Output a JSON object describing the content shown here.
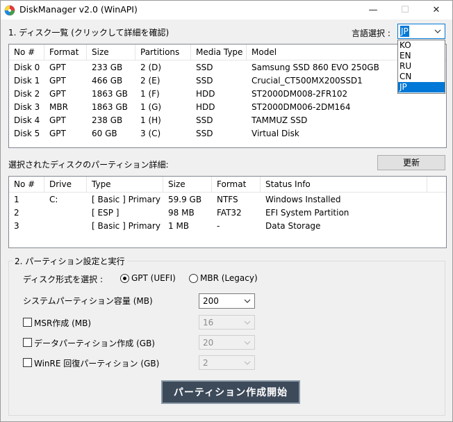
{
  "window": {
    "title": "DiskManager v2.0 (WinAPI)"
  },
  "titlebar": {
    "minimize": "—",
    "maximize": "☐",
    "close": "✕"
  },
  "disk_section": {
    "label": "1. ディスク一覧 (クリックして詳細を確認)"
  },
  "language": {
    "label": "言語選択 :",
    "selected": "JP",
    "options": [
      "KO",
      "EN",
      "RU",
      "CN",
      "JP"
    ]
  },
  "disk_table": {
    "columns": [
      "No #",
      "Format",
      "Size",
      "Partitions",
      "Media Type",
      "Model"
    ],
    "rows": [
      [
        "Disk 0",
        "GPT",
        "233 GB",
        "2 (D)",
        "SSD",
        "Samsung SSD 860 EVO 250GB"
      ],
      [
        "Disk 1",
        "GPT",
        "466 GB",
        "2 (E)",
        "SSD",
        "Crucial_CT500MX200SSD1"
      ],
      [
        "Disk 2",
        "GPT",
        "1863 GB",
        "1 (F)",
        "HDD",
        "ST2000DM008-2FR102"
      ],
      [
        "Disk 3",
        "MBR",
        "1863 GB",
        "1 (G)",
        "HDD",
        "ST2000DM006-2DM164"
      ],
      [
        "Disk 4",
        "GPT",
        "238 GB",
        "1 (H)",
        "SSD",
        "TAMMUZ SSD"
      ],
      [
        "Disk 5",
        "GPT",
        "60 GB",
        "3 (C)",
        "SSD",
        "Virtual Disk"
      ]
    ]
  },
  "partition_section": {
    "label": "選択されたディスクのパーティション詳細:",
    "refresh": "更新"
  },
  "partition_table": {
    "columns": [
      "No #",
      "Drive",
      "Type",
      "Size",
      "Format",
      "Status Info"
    ],
    "rows": [
      [
        "1",
        "C:",
        "[ Basic ] Primary",
        "59.9 GB",
        "NTFS",
        "Windows Installed"
      ],
      [
        "2",
        "",
        "[ ESP ]",
        "98 MB",
        "FAT32",
        "EFI System Partition"
      ],
      [
        "3",
        "",
        "[ Basic ] Primary",
        "1 MB",
        "-",
        "Data Storage"
      ]
    ]
  },
  "settings": {
    "group_label": "2. パーティション設定と実行",
    "disk_format_label": "ディスク形式を選択 :",
    "gpt_option": "GPT (UEFI)",
    "mbr_option": "MBR (Legacy)",
    "gpt_selected": true,
    "system_size_label": "システムパーティション容量 (MB)",
    "system_size_value": "200",
    "msr_label": "MSR作成 (MB)",
    "msr_value": "16",
    "data_label": "データパーティション作成 (GB)",
    "data_value": "20",
    "winre_label": "WinRE 回復パーティション (GB)",
    "winre_value": "2",
    "create_button": "パーティション作成開始"
  }
}
